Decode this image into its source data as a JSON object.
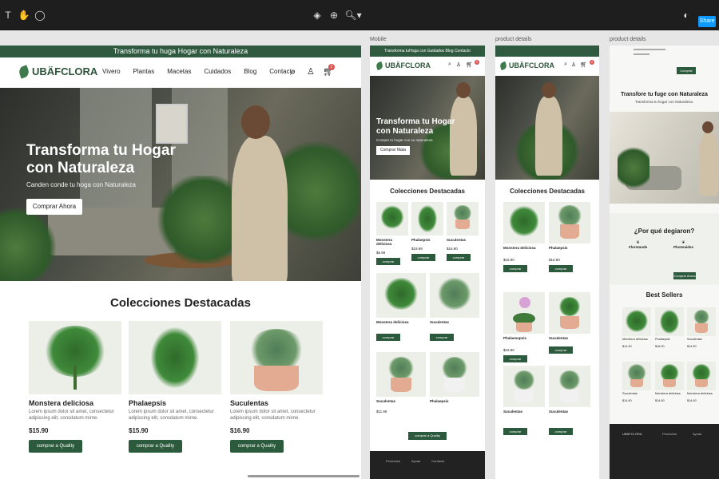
{
  "toolbar": {
    "share_label": "Share"
  },
  "frame_labels": {
    "mobile": "Mobile",
    "product1": "product details",
    "product2": "product details"
  },
  "main": {
    "announcement": "Transforma tu huga Hogar con Naturaleza",
    "logo": "UBÄFCLORA",
    "nav": [
      "Vivero",
      "Plantas",
      "Macetas",
      "Cuidados",
      "Blog",
      "Contacto"
    ],
    "cart_count": "2",
    "hero": {
      "title_line1": "Transforma tu Hogar",
      "title_line2": "con Naturaleza",
      "subtitle": "Canden conde tu hoga con Naturaleza",
      "cta": "Comprar Ahora"
    },
    "section_title": "Colecciones Destacadas",
    "products": [
      {
        "name": "Monstera deliciosa",
        "desc": "Lorem ipsum dolor sit amet, consectetur adipiscing elit, consdatum mirne.",
        "price": "$15.90",
        "cta": "comprar a Quality"
      },
      {
        "name": "Phalaepsis",
        "desc": "Lorem ipsum dolor sit amet, consectetur adipiscing elit, consdatum mirne.",
        "price": "$15.90",
        "cta": "comprar a Quality"
      },
      {
        "name": "Suculentas",
        "desc": "Lorem ipsum dolor sit amet, consectetur adipiscing elit, consdatum mirne.",
        "price": "$16.90",
        "cta": "comprar a Quality"
      }
    ]
  },
  "mobile": {
    "announcement": "Transforma tuHoga con Guidados Blog Contacto",
    "logo": "UBÄFCLORA",
    "cart_count": "2",
    "hero": {
      "title_line1": "Transforma tu Hogar",
      "title_line2": "con Naturaleza",
      "subtitle": "Compre tu hogar con su naturaleza",
      "cta": "Comprar Mata"
    },
    "section_title": "Colecciones Destacadas",
    "row1": [
      {
        "name": "Monstera deliciosa",
        "price": "$5.99",
        "cta": "comprar"
      },
      {
        "name": "Phalaepsis",
        "price": "$19.99",
        "cta": "comprar"
      },
      {
        "name": "Suculentas",
        "price": "$16.90",
        "cta": "comprar"
      }
    ],
    "row2": [
      {
        "name": "Monstera deliciosa",
        "cta": "comprar"
      },
      {
        "name": "Suculentas",
        "cta": "comprar"
      }
    ],
    "row3": [
      {
        "name": "Suculentas",
        "price": "$11.99",
        "cta": ""
      },
      {
        "name": "Phalaepsis",
        "price": "",
        "cta": ""
      }
    ],
    "load_more": "comprar a Quality",
    "footer_cols": [
      "Productos",
      "Ayuda",
      "Contacto"
    ]
  },
  "product1": {
    "logo": "UBÄFCLORA",
    "cart_count": "2",
    "section_title": "Colecciones Destacadas",
    "items": [
      {
        "name": "Monstera deliciosa",
        "price": "$16.90",
        "cta": "comprar"
      },
      {
        "name": "Phalaepsis",
        "price": "$16.90",
        "cta": "comprar"
      },
      {
        "name": "Phalaenopsis",
        "price": "$16.90",
        "cta": "comprar"
      },
      {
        "name": "Suculentas",
        "price": "",
        "cta": "comprar"
      },
      {
        "name": "Suculentas",
        "price": "",
        "cta": "comprar"
      },
      {
        "name": "Suculentas",
        "price": "",
        "cta": "comprar"
      }
    ]
  },
  "product2": {
    "top_button": "Comprar",
    "hero_title": "Transfore tu fuge con Naturaleza",
    "hero_sub": "Transforma tu hogar con Naturaleza.",
    "why_title": "¿Por qué degiaron?",
    "features": [
      {
        "title": "Florotande"
      },
      {
        "title": "Plosteaides"
      }
    ],
    "why_cta": "Comprar Ahora",
    "bestsellers_title": "Best Sellers",
    "bs_row1": [
      {
        "name": "Monstera deliciosa",
        "price": "$14.90"
      },
      {
        "name": "Phalaepsis",
        "price": "$16.90"
      },
      {
        "name": "Suculentas",
        "price": "$14.90"
      }
    ],
    "bs_row2": [
      {
        "name": "Suculentas",
        "price": "$14.90"
      },
      {
        "name": "Monstera deliciosa",
        "price": "$14.90"
      },
      {
        "name": "Monstera deliciosa",
        "price": "$14.90"
      }
    ],
    "footer_logo": "UBÄFCLORA",
    "footer_cols": [
      "Productos",
      "Ayuda"
    ]
  }
}
